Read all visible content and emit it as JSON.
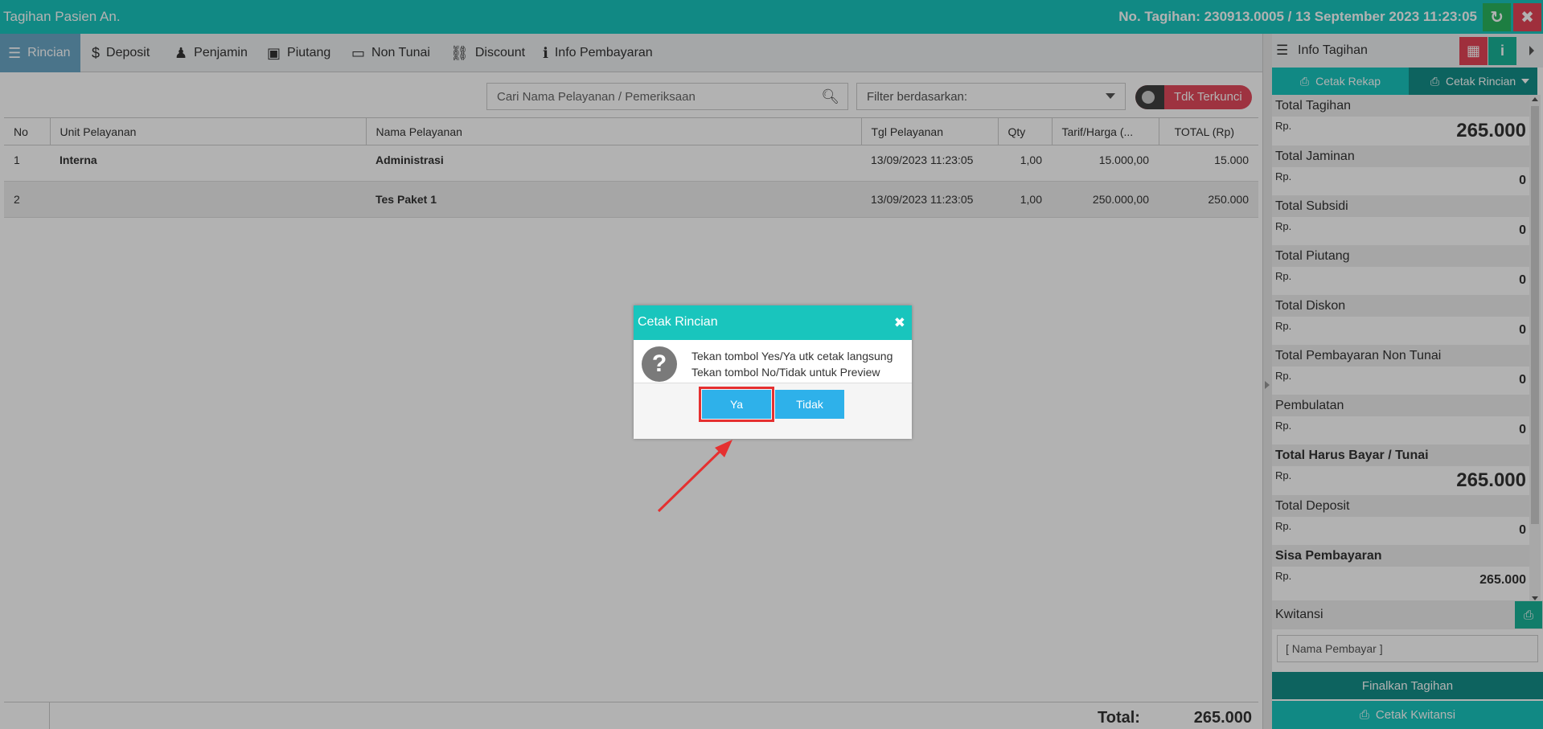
{
  "window": {
    "title": "Tagihan Pasien An.",
    "invoice_info": "No. Tagihan: 230913.0005 / 13 September 2023 11:23:05"
  },
  "tabs": [
    {
      "label": "Rincian",
      "icon": "list-icon",
      "active": true
    },
    {
      "label": "Deposit",
      "icon": "dollar-icon"
    },
    {
      "label": "Penjamin",
      "icon": "user-secret-icon"
    },
    {
      "label": "Piutang",
      "icon": "money-icon"
    },
    {
      "label": "Non Tunai",
      "icon": "credit-card-icon"
    },
    {
      "label": "Discount",
      "icon": "chain-broken-icon"
    },
    {
      "label": "Info Pembayaran",
      "icon": "info-icon"
    }
  ],
  "toolbar": {
    "search_placeholder": "Cari Nama Pelayanan / Pemeriksaan",
    "filter_placeholder": "Filter berdasarkan:",
    "toggle_label": "Tdk Terkunci"
  },
  "table": {
    "headers": [
      "No",
      "Unit Pelayanan",
      "Nama Pelayanan",
      "Tgl Pelayanan",
      "Qty",
      "Tarif/Harga (...",
      "TOTAL (Rp)"
    ],
    "rows": [
      {
        "no": "1",
        "unit": "Interna",
        "nama": "Administrasi",
        "tgl": "13/09/2023 11:23:05",
        "qty": "1,00",
        "tarif": "15.000,00",
        "total": "15.000"
      },
      {
        "no": "2",
        "unit": "",
        "nama": "Tes Paket 1",
        "tgl": "13/09/2023 11:23:05",
        "qty": "1,00",
        "tarif": "250.000,00",
        "total": "250.000"
      }
    ],
    "footer_label": "Total:",
    "footer_value": "265.000"
  },
  "side": {
    "title": "Info Tagihan",
    "cetak_rekap": "Cetak Rekap",
    "cetak_rincian": "Cetak Rincian",
    "currency": "Rp.",
    "items": [
      {
        "label": "Total Tagihan",
        "value": "265.000",
        "big": true
      },
      {
        "label": "Total Jaminan",
        "value": "0"
      },
      {
        "label": "Total Subsidi",
        "value": "0"
      },
      {
        "label": "Total Piutang",
        "value": "0"
      },
      {
        "label": "Total Diskon",
        "value": "0"
      },
      {
        "label": "Total Pembayaran Non Tunai",
        "value": "0"
      },
      {
        "label": "Pembulatan",
        "value": "0"
      },
      {
        "label": "Total Harus Bayar / Tunai",
        "value": "265.000",
        "big": true,
        "bold": true
      },
      {
        "label": "Total Deposit",
        "value": "0"
      },
      {
        "label": "Sisa Pembayaran",
        "value": "265.000",
        "bold": true
      }
    ],
    "kwitansi_label": "Kwitansi",
    "nama_pembayar_placeholder": "[ Nama Pembayar ]",
    "finalkan_label": "Finalkan Tagihan",
    "cetak_kwitansi_label": "Cetak Kwitansi"
  },
  "dialog": {
    "title": "Cetak Rincian",
    "line1": "Tekan tombol Yes/Ya utk cetak langsung",
    "line2": "Tekan tombol No/Tidak untuk Preview",
    "yes_label": "Ya",
    "no_label": "Tidak"
  },
  "colors": {
    "primary": "#19c5bd",
    "primary_dark": "#148f88",
    "danger": "#e44457",
    "button": "#2eb1ea",
    "highlight": "#e53030"
  }
}
